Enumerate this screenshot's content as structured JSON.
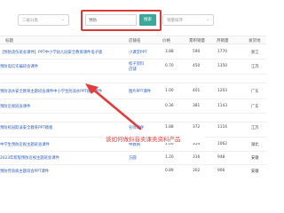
{
  "toolbar": {
    "category_placeholder": "二级分类",
    "search_value": "预防",
    "search_button": "搜索",
    "sort_placeholder": "销量排序"
  },
  "table": {
    "headers": [
      "标题",
      "店铺名",
      "价格",
      "累积销量",
      "月销量",
      "发货地"
    ],
    "rows": [
      {
        "title": "【预防烫伤班会课件】PPT中小学幼儿园安全教育课件电子版",
        "shop": [
          "小课堂PPT",
          ""
        ],
        "price": "3.88",
        "sales": "590",
        "monthly": "1770",
        "location": "浙江"
      },
      {
        "title": "预防电信诈骗班会课件",
        "shop": [
          "松子资料",
          "店铺"
        ],
        "price": "0.70",
        "sales": "450",
        "monthly": "1350",
        "location": "江苏"
      },
      {
        "title": "",
        "shop": [
          "",
          ""
        ],
        "price": "",
        "sales": "",
        "monthly": "",
        "location": ""
      },
      {
        "title": "预防溺水安全教育主题班会课件中小学生防溺水PPT模板课件",
        "shop": [
          "图片PPT课件",
          ""
        ],
        "price": "1.00",
        "sales": "401",
        "monthly": "1203",
        "location": "广东"
      },
      {
        "title": "预防近视班会课件",
        "shop": [
          "",
          ""
        ],
        "price": "0.36",
        "sales": "381",
        "monthly": "1143",
        "location": "广东"
      },
      {
        "title": "",
        "shop": [
          "",
          ""
        ],
        "price": "",
        "sales": "",
        "monthly": "",
        "location": ""
      },
      {
        "title": "预防校园欺凌安全教育PPT模板",
        "shop": [
          "名师课件",
          ""
        ],
        "price": "1.88",
        "sales": "372",
        "monthly": "1116",
        "location": "江苏"
      },
      {
        "title": "中学生预防近视主题班会课件",
        "shop": [
          "中教网",
          ""
        ],
        "price": "1.00",
        "sales": "354",
        "monthly": "1062",
        "location": "湖北"
      },
      {
        "title": "2023年新版预防近视主题班会课件",
        "shop": [
          "方圆",
          ""
        ],
        "price": "1.20",
        "sales": "316",
        "monthly": "948",
        "location": "安徽"
      },
      {
        "title": "预防传染病主题班会PPT课件",
        "shop": [
          "",
          ""
        ],
        "price": "0.89",
        "sales": "302",
        "monthly": "906",
        "location": "安徽"
      }
    ]
  },
  "annotation": {
    "text": "该如何做抖音卖课卖资料产品"
  },
  "colors": {
    "accent_green": "#3aa89a",
    "highlight_red": "#d83a3a",
    "link_blue": "#2f5fbf"
  }
}
